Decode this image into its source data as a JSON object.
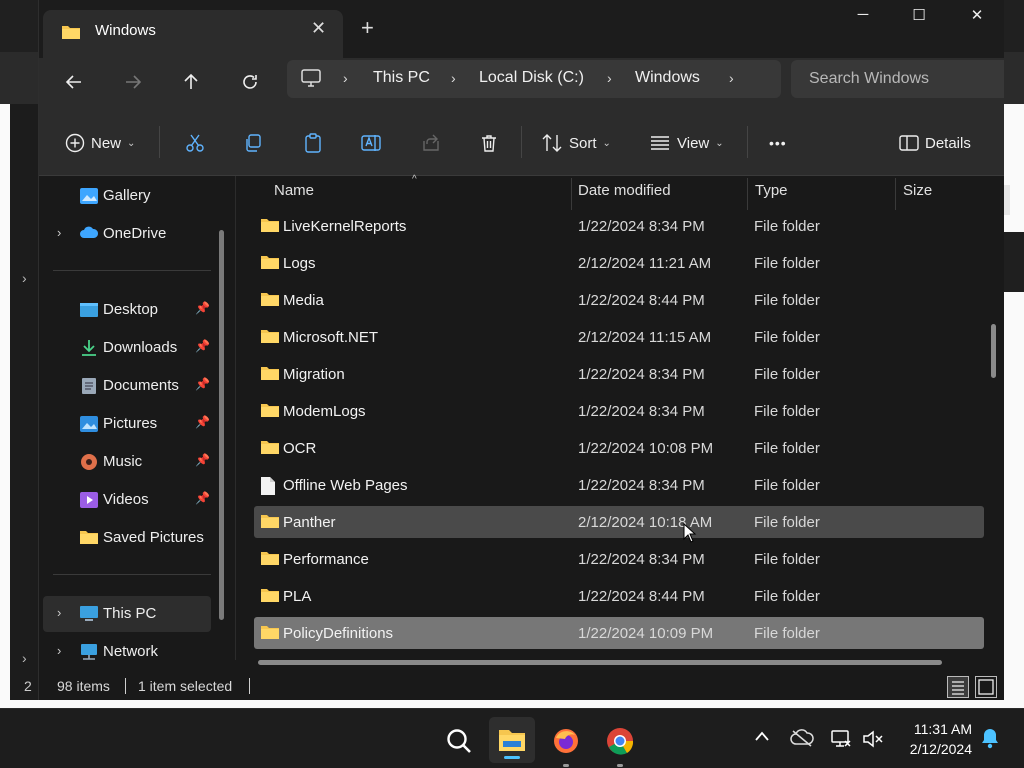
{
  "window": {
    "tab_title": "Windows",
    "new_tab": "+",
    "controls": {
      "minimize": "─",
      "maximize": "☐",
      "close": "✕"
    }
  },
  "navigation": {
    "breadcrumb": [
      "This PC",
      "Local Disk (C:)",
      "Windows"
    ],
    "search_placeholder": "Search Windows"
  },
  "toolbar": {
    "new_label": "New",
    "sort_label": "Sort",
    "view_label": "View",
    "details_label": "Details",
    "more_label": "•••"
  },
  "sidebar": {
    "top": [
      {
        "label": "Gallery",
        "icon": "gallery-icon",
        "chevron": false
      },
      {
        "label": "OneDrive",
        "icon": "cloud-icon",
        "chevron": true
      }
    ],
    "quick_access": [
      {
        "label": "Desktop",
        "icon": "desktop-icon",
        "pinned": true
      },
      {
        "label": "Downloads",
        "icon": "download-icon",
        "pinned": true
      },
      {
        "label": "Documents",
        "icon": "document-icon",
        "pinned": true
      },
      {
        "label": "Pictures",
        "icon": "picture-icon",
        "pinned": true
      },
      {
        "label": "Music",
        "icon": "music-icon",
        "pinned": true
      },
      {
        "label": "Videos",
        "icon": "video-icon",
        "pinned": true
      },
      {
        "label": "Saved Pictures",
        "icon": "folder-icon",
        "pinned": false
      }
    ],
    "locations": [
      {
        "label": "This PC",
        "icon": "pc-icon",
        "selected": true
      },
      {
        "label": "Network",
        "icon": "network-icon",
        "selected": false
      }
    ]
  },
  "columns": {
    "name": "Name",
    "date": "Date modified",
    "type": "Type",
    "size": "Size"
  },
  "files": [
    {
      "name": "LiveKernelReports",
      "date": "1/22/2024 8:34 PM",
      "type": "File folder",
      "icon": "folder-icon"
    },
    {
      "name": "Logs",
      "date": "2/12/2024 11:21 AM",
      "type": "File folder",
      "icon": "folder-icon"
    },
    {
      "name": "Media",
      "date": "1/22/2024 8:44 PM",
      "type": "File folder",
      "icon": "folder-icon"
    },
    {
      "name": "Microsoft.NET",
      "date": "2/12/2024 11:15 AM",
      "type": "File folder",
      "icon": "folder-icon"
    },
    {
      "name": "Migration",
      "date": "1/22/2024 8:34 PM",
      "type": "File folder",
      "icon": "folder-icon"
    },
    {
      "name": "ModemLogs",
      "date": "1/22/2024 8:34 PM",
      "type": "File folder",
      "icon": "folder-icon"
    },
    {
      "name": "OCR",
      "date": "1/22/2024 10:08 PM",
      "type": "File folder",
      "icon": "folder-icon"
    },
    {
      "name": "Offline Web Pages",
      "date": "1/22/2024 8:34 PM",
      "type": "File folder",
      "icon": "file-icon"
    },
    {
      "name": "Panther",
      "date": "2/12/2024 10:18 AM",
      "type": "File folder",
      "icon": "folder-icon",
      "state": "hover"
    },
    {
      "name": "Performance",
      "date": "1/22/2024 8:34 PM",
      "type": "File folder",
      "icon": "folder-icon"
    },
    {
      "name": "PLA",
      "date": "1/22/2024 8:44 PM",
      "type": "File folder",
      "icon": "folder-icon"
    },
    {
      "name": "PolicyDefinitions",
      "date": "1/22/2024 10:09 PM",
      "type": "File folder",
      "icon": "folder-icon",
      "state": "selected"
    }
  ],
  "status": {
    "count": "98 items",
    "selected": "1 item selected"
  },
  "background": {
    "stray_number": "2"
  },
  "taskbar": {
    "time": "11:31 AM",
    "date": "2/12/2024",
    "apps": [
      "search-icon",
      "file-explorer-icon",
      "firefox-icon",
      "chrome-icon"
    ]
  },
  "colors": {
    "folder": "#f6c64f",
    "accent": "#4cc2ff",
    "selected_row": "#777777",
    "hover_row": "#4a4a4a"
  }
}
